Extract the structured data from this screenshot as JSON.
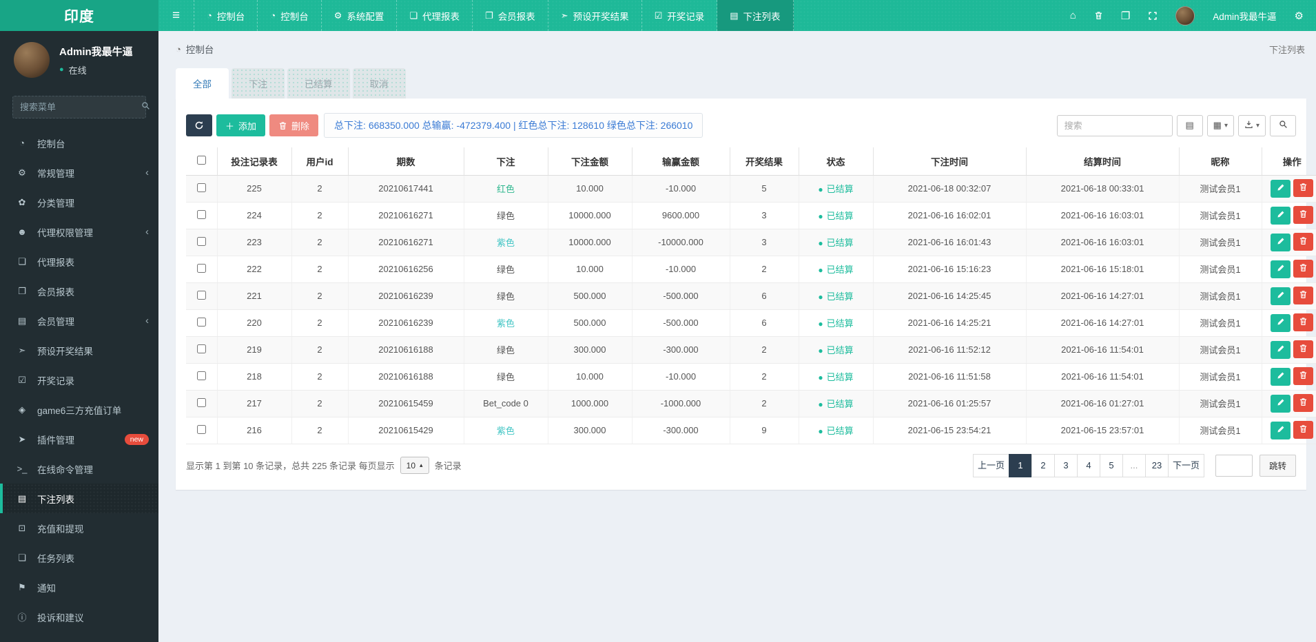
{
  "colors": {
    "navbar_teal": "#1eb998",
    "logo_teal": "#18a586",
    "navbar_active": "#17997e",
    "sidebar_dark": "#222d32",
    "primary_teal": "#1dbc9d",
    "dark_navy": "#2c3e50",
    "soft_red": "#ef8a80",
    "danger_red": "#e74c3c",
    "summary_blue": "#3a7bd5",
    "bet_red_link": "#2eb78e",
    "bet_purple_link": "#41c5c4",
    "content_bg": "#ecf0f5"
  },
  "icons": {
    "hamburger-icon": "≡",
    "dashboard-icon": "◔",
    "gear-icon": "⚙",
    "gears-icon": "⚙",
    "book-icon": "❏",
    "address-book-icon": "❐",
    "send-icon": "➣",
    "calendar-check-icon": "☑",
    "list-icon": "▤",
    "leaf-icon": "✿",
    "users-icon": "☻",
    "gem-icon": "◈",
    "rocket-icon": "➤",
    "terminal-icon": ">_",
    "money-icon": "⊡",
    "bullhorn-icon": "⚑",
    "info-icon": "ⓘ",
    "home-icon": "⌂",
    "chevron-left-icon": "‹",
    "caret-down-icon": "▾",
    "caret-up-icon": "▴",
    "grid-icon": "▦",
    "detail-list-icon": "▤",
    "dot-icon": "●",
    "plus-icon": "＋",
    "clear-cache-icon": "❐"
  },
  "navbar": {
    "logo": "印度",
    "items": [
      {
        "id": "dashboard-1",
        "label": "控制台",
        "icon": "dashboard-icon",
        "active": false
      },
      {
        "id": "dashboard-2",
        "label": "控制台",
        "icon": "dashboard-icon",
        "active": false
      },
      {
        "id": "system-config",
        "label": "系统配置",
        "icon": "gear-icon",
        "active": false
      },
      {
        "id": "agent-report",
        "label": "代理报表",
        "icon": "book-icon",
        "active": false
      },
      {
        "id": "member-report",
        "label": "会员报表",
        "icon": "address-book-icon",
        "active": false
      },
      {
        "id": "preset-result",
        "label": "预设开奖结果",
        "icon": "send-icon",
        "active": false
      },
      {
        "id": "draw-record",
        "label": "开奖记录",
        "icon": "calendar-check-icon",
        "active": false
      },
      {
        "id": "bet-list",
        "label": "下注列表",
        "icon": "list-icon",
        "active": true
      }
    ],
    "user_name": "Admin我最牛逼"
  },
  "sidebar": {
    "user": {
      "name": "Admin我最牛逼",
      "status": "在线"
    },
    "search_placeholder": "搜索菜单",
    "items": [
      {
        "id": "dashboard",
        "label": "控制台",
        "icon": "dashboard-icon",
        "children": false,
        "active": false,
        "badge": ""
      },
      {
        "id": "general-mgmt",
        "label": "常规管理",
        "icon": "gears-icon",
        "children": true,
        "active": false,
        "badge": ""
      },
      {
        "id": "category-mgmt",
        "label": "分类管理",
        "icon": "leaf-icon",
        "children": false,
        "active": false,
        "badge": ""
      },
      {
        "id": "agent-perm-mgmt",
        "label": "代理权限管理",
        "icon": "users-icon",
        "children": true,
        "active": false,
        "badge": ""
      },
      {
        "id": "agent-report",
        "label": "代理报表",
        "icon": "book-icon",
        "children": false,
        "active": false,
        "badge": ""
      },
      {
        "id": "member-report",
        "label": "会员报表",
        "icon": "address-book-icon",
        "children": false,
        "active": false,
        "badge": ""
      },
      {
        "id": "member-mgmt",
        "label": "会员管理",
        "icon": "list-icon",
        "children": true,
        "active": false,
        "badge": ""
      },
      {
        "id": "preset-result",
        "label": "预设开奖结果",
        "icon": "send-icon",
        "children": false,
        "active": false,
        "badge": ""
      },
      {
        "id": "draw-record",
        "label": "开奖记录",
        "icon": "calendar-check-icon",
        "children": false,
        "active": false,
        "badge": ""
      },
      {
        "id": "game6-orders",
        "label": "game6三方充值订单",
        "icon": "gem-icon",
        "children": false,
        "active": false,
        "badge": ""
      },
      {
        "id": "plugin-mgmt",
        "label": "插件管理",
        "icon": "rocket-icon",
        "children": false,
        "active": false,
        "badge": "new"
      },
      {
        "id": "online-command",
        "label": "在线命令管理",
        "icon": "terminal-icon",
        "children": false,
        "active": false,
        "badge": ""
      },
      {
        "id": "bet-list",
        "label": "下注列表",
        "icon": "list-icon",
        "children": false,
        "active": true,
        "badge": ""
      },
      {
        "id": "recharge-withdraw",
        "label": "充值和提现",
        "icon": "money-icon",
        "children": false,
        "active": false,
        "badge": ""
      },
      {
        "id": "task-list",
        "label": "任务列表",
        "icon": "book-icon",
        "children": false,
        "active": false,
        "badge": ""
      },
      {
        "id": "notice",
        "label": "通知",
        "icon": "bullhorn-icon",
        "children": false,
        "active": false,
        "badge": ""
      },
      {
        "id": "complaints",
        "label": "投诉和建议",
        "icon": "info-icon",
        "children": false,
        "active": false,
        "badge": ""
      }
    ]
  },
  "breadcrumb": {
    "left": "控制台",
    "right": "下注列表"
  },
  "tabs": [
    {
      "label": "全部",
      "active": true
    },
    {
      "label": "下注",
      "active": false
    },
    {
      "label": "已结算",
      "active": false
    },
    {
      "label": "取消",
      "active": false
    }
  ],
  "toolbar": {
    "add_label": "添加",
    "delete_label": "删除",
    "summary": "总下注: 668350.000 总输赢: -472379.400 | 红色总下注: 128610 绿色总下注: 266010",
    "search_placeholder": "搜索"
  },
  "table": {
    "columns": [
      "投注记录表",
      "用户id",
      "期数",
      "下注",
      "下注金额",
      "输赢金额",
      "开奖结果",
      "状态",
      "下注时间",
      "结算时间",
      "昵称",
      "操作"
    ],
    "rows": [
      {
        "id": "225",
        "user_id": "2",
        "period": "20210617441",
        "bet": "红色",
        "bet_style": "red",
        "amount": "10.000",
        "win": "-10.000",
        "result": "5",
        "status": "已结算",
        "bet_time": "2021-06-18 00:32:07",
        "settle_time": "2021-06-18 00:33:01",
        "nickname": "测试会员1"
      },
      {
        "id": "224",
        "user_id": "2",
        "period": "20210616271",
        "bet": "绿色",
        "bet_style": "plain",
        "amount": "10000.000",
        "win": "9600.000",
        "result": "3",
        "status": "已结算",
        "bet_time": "2021-06-16 16:02:01",
        "settle_time": "2021-06-16 16:03:01",
        "nickname": "测试会员1"
      },
      {
        "id": "223",
        "user_id": "2",
        "period": "20210616271",
        "bet": "紫色",
        "bet_style": "purple",
        "amount": "10000.000",
        "win": "-10000.000",
        "result": "3",
        "status": "已结算",
        "bet_time": "2021-06-16 16:01:43",
        "settle_time": "2021-06-16 16:03:01",
        "nickname": "测试会员1"
      },
      {
        "id": "222",
        "user_id": "2",
        "period": "20210616256",
        "bet": "绿色",
        "bet_style": "plain",
        "amount": "10.000",
        "win": "-10.000",
        "result": "2",
        "status": "已结算",
        "bet_time": "2021-06-16 15:16:23",
        "settle_time": "2021-06-16 15:18:01",
        "nickname": "测试会员1"
      },
      {
        "id": "221",
        "user_id": "2",
        "period": "20210616239",
        "bet": "绿色",
        "bet_style": "plain",
        "amount": "500.000",
        "win": "-500.000",
        "result": "6",
        "status": "已结算",
        "bet_time": "2021-06-16 14:25:45",
        "settle_time": "2021-06-16 14:27:01",
        "nickname": "测试会员1"
      },
      {
        "id": "220",
        "user_id": "2",
        "period": "20210616239",
        "bet": "紫色",
        "bet_style": "purple",
        "amount": "500.000",
        "win": "-500.000",
        "result": "6",
        "status": "已结算",
        "bet_time": "2021-06-16 14:25:21",
        "settle_time": "2021-06-16 14:27:01",
        "nickname": "测试会员1"
      },
      {
        "id": "219",
        "user_id": "2",
        "period": "20210616188",
        "bet": "绿色",
        "bet_style": "plain",
        "amount": "300.000",
        "win": "-300.000",
        "result": "2",
        "status": "已结算",
        "bet_time": "2021-06-16 11:52:12",
        "settle_time": "2021-06-16 11:54:01",
        "nickname": "测试会员1"
      },
      {
        "id": "218",
        "user_id": "2",
        "period": "20210616188",
        "bet": "绿色",
        "bet_style": "plain",
        "amount": "10.000",
        "win": "-10.000",
        "result": "2",
        "status": "已结算",
        "bet_time": "2021-06-16 11:51:58",
        "settle_time": "2021-06-16 11:54:01",
        "nickname": "测试会员1"
      },
      {
        "id": "217",
        "user_id": "2",
        "period": "20210615459",
        "bet": "Bet_code 0",
        "bet_style": "plain",
        "amount": "1000.000",
        "win": "-1000.000",
        "result": "2",
        "status": "已结算",
        "bet_time": "2021-06-16 01:25:57",
        "settle_time": "2021-06-16 01:27:01",
        "nickname": "测试会员1"
      },
      {
        "id": "216",
        "user_id": "2",
        "period": "20210615429",
        "bet": "紫色",
        "bet_style": "purple",
        "amount": "300.000",
        "win": "-300.000",
        "result": "9",
        "status": "已结算",
        "bet_time": "2021-06-15 23:54:21",
        "settle_time": "2021-06-15 23:57:01",
        "nickname": "测试会员1"
      }
    ]
  },
  "pagination": {
    "info_prefix": "显示第 1 到第 10 条记录，总共 225 条记录 每页显示",
    "per_page": "10",
    "info_suffix": "条记录",
    "prev": "上一页",
    "next": "下一页",
    "pages": [
      "1",
      "2",
      "3",
      "4",
      "5",
      "...",
      "23"
    ],
    "active_page": "1",
    "jump": "跳转"
  }
}
